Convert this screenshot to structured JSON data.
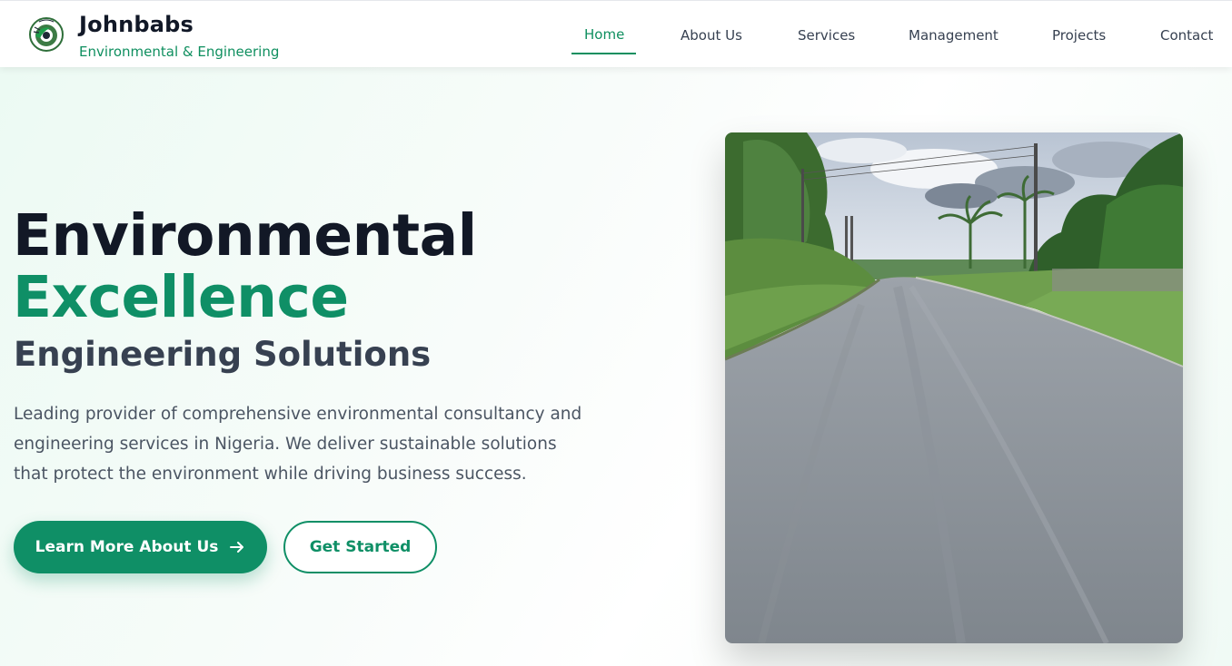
{
  "brand": {
    "name": "Johnbabs",
    "tagline": "Environmental & Engineering",
    "logo_icon": "gear-leaf-logo-icon"
  },
  "nav": {
    "items": [
      {
        "label": "Home",
        "active": true
      },
      {
        "label": "About Us",
        "active": false
      },
      {
        "label": "Services",
        "active": false
      },
      {
        "label": "Management",
        "active": false
      },
      {
        "label": "Projects",
        "active": false
      },
      {
        "label": "Contact",
        "active": false
      }
    ]
  },
  "hero": {
    "title_line1": "Environmental",
    "title_line2": "Excellence",
    "subtitle": "Engineering Solutions",
    "description": "Leading provider of comprehensive environmental consultancy and engineering services in Nigeria. We deliver sustainable solutions that protect the environment while driving business success.",
    "primary_button": "Learn More About Us",
    "primary_button_icon": "arrow-right-icon",
    "secondary_button": "Get Started",
    "image_subject": "paved rural road with vegetation and palm trees"
  },
  "colors": {
    "accent": "#0f8f66",
    "heading": "#121826",
    "text": "#4b5563"
  }
}
